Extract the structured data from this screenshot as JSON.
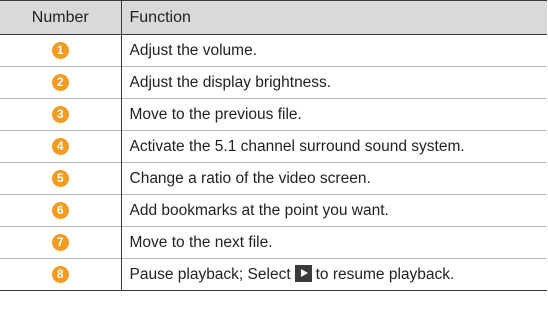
{
  "table": {
    "headers": {
      "number": "Number",
      "function": "Function"
    },
    "rows": [
      {
        "number": "1",
        "function": "Adjust the volume."
      },
      {
        "number": "2",
        "function": "Adjust the display brightness."
      },
      {
        "number": "3",
        "function": "Move to the previous file."
      },
      {
        "number": "4",
        "function": "Activate the 5.1 channel surround sound system."
      },
      {
        "number": "5",
        "function": "Change a ratio of the video screen."
      },
      {
        "number": "6",
        "function": "Add bookmarks at the point you want."
      },
      {
        "number": "7",
        "function": "Move to the next file."
      },
      {
        "number": "8",
        "function_before_icon": "Pause playback; Select",
        "function_icon": "play-icon",
        "function_after_icon": "to resume playback."
      }
    ]
  },
  "colors": {
    "badge": "#f39b1f",
    "header_bg": "#d9d9d9",
    "play_icon_bg": "#3a3a3a"
  }
}
